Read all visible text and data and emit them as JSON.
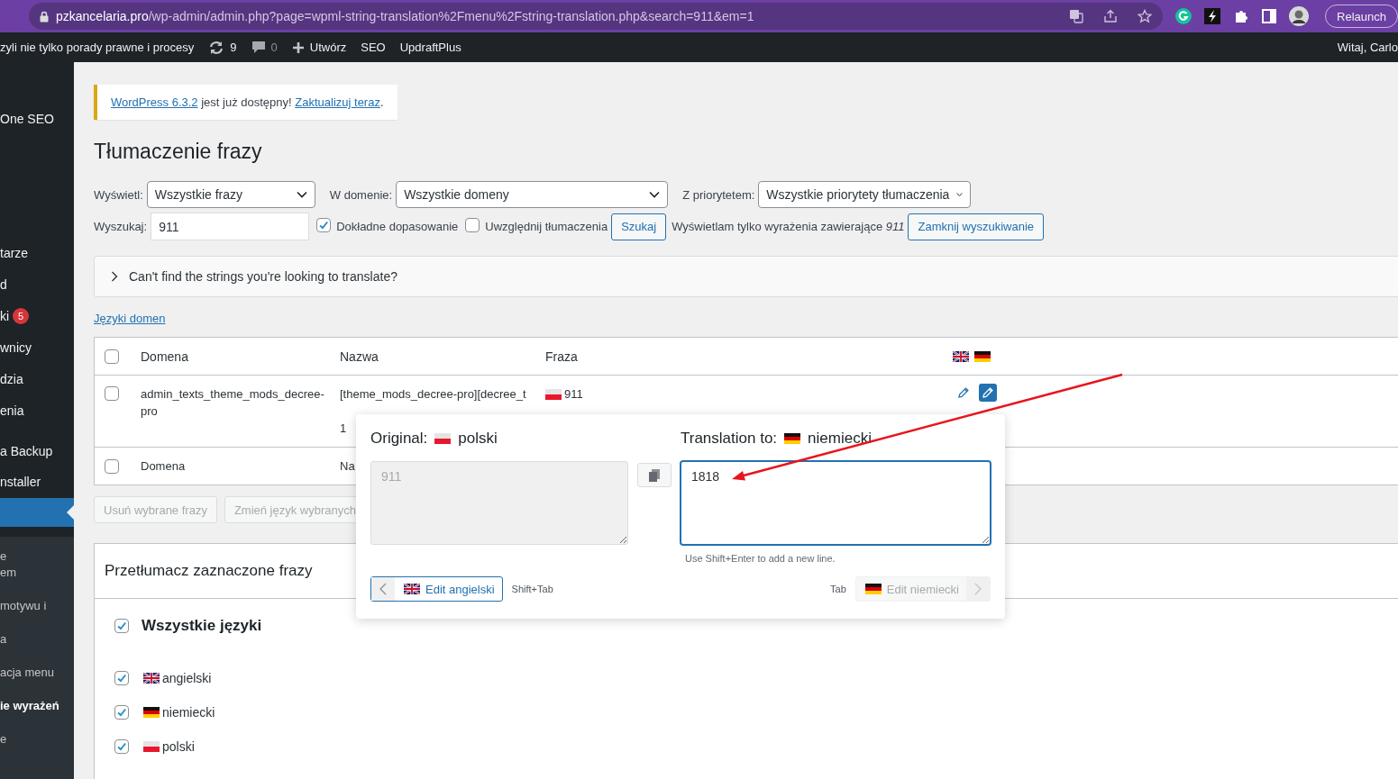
{
  "browser": {
    "url_host": "pzkancelaria.pro",
    "url_path": "/wp-admin/admin.php?page=wpml-string-translation%2Fmenu%2Fstring-translation.php&search=911&em=1",
    "relaunch": "Relaunch"
  },
  "admin_bar": {
    "site": "zyli nie tylko porady prawne i procesy",
    "updates": "9",
    "comments": "0",
    "new": "Utwórz",
    "items": [
      "SEO",
      "UpdraftPlus"
    ],
    "greeting": "Witaj, Carlo"
  },
  "sidebar": {
    "groups": [
      {
        "items": [
          {
            "label": "One SEO",
            "selected": false
          }
        ]
      },
      {
        "items": [
          {
            "label": "tarze",
            "selected": false
          },
          {
            "label": "d",
            "selected": false
          },
          {
            "label": "ki",
            "badge": "5",
            "selected": false
          },
          {
            "label": "wnicy",
            "selected": false
          },
          {
            "label": "dzia",
            "selected": false
          },
          {
            "label": "enia",
            "selected": false
          }
        ]
      },
      {
        "items": [
          {
            "label": "a Backup",
            "selected": false
          },
          {
            "label": "nstaller",
            "selected": false
          },
          {
            "selected": true
          }
        ]
      }
    ],
    "submenu": [
      {
        "lines": [
          "e",
          "em"
        ],
        "selected": false
      },
      {
        "lines": [
          "motywu i"
        ],
        "selected": false
      },
      {
        "lines": [
          "a"
        ],
        "selected": false
      },
      {
        "lines": [
          "acja menu"
        ],
        "selected": false
      },
      {
        "lines": [
          "ie wyrażeń"
        ],
        "selected": true
      },
      {
        "lines": [
          "e"
        ],
        "selected": false
      }
    ]
  },
  "notice": {
    "parts": [
      {
        "text": "WordPress 6.3.2",
        "kind": "link"
      },
      {
        "text": " jest już dostępny! ",
        "kind": "text"
      },
      {
        "text": "Zaktualizuj teraz",
        "kind": "link"
      },
      {
        "text": ".",
        "kind": "text"
      }
    ]
  },
  "title": "Tłumaczenie frazy",
  "filters": [
    {
      "label": "Wyświetl:",
      "value": "Wszystkie frazy"
    },
    {
      "label": "W domenie:",
      "value": "Wszystkie domeny"
    },
    {
      "label": "Z priorytetem:",
      "value": "Wszystkie priorytety tłumaczenia"
    }
  ],
  "search": {
    "label": "Wyszukaj:",
    "value": "911",
    "options": [
      {
        "label": "Dokładne dopasowanie",
        "checked": true
      },
      {
        "label": "Uwzględnij tłumaczenia",
        "checked": false
      }
    ],
    "button": "Szukaj",
    "info": "Wyświetlam tylko wyrażenia zawierające *911*",
    "close_button": "Zamknij wyszukiwanie"
  },
  "help_panel": {
    "text": "Can't find the strings you're looking to translate?",
    "expanded": false
  },
  "domain_languages_link": "Języki domen",
  "table": {
    "columns": [
      "Domena",
      "Nazwa",
      "Fraza"
    ],
    "header_checked": false,
    "header_flags": [
      {
        "kind": "gb"
      },
      {
        "kind": "de"
      }
    ],
    "rows": [
      {
        "checked": false,
        "domain": "admin_texts_theme_mods_decree-pro",
        "name_lines": [
          "[theme_mods_decree-pro][decree_t",
          "1"
        ],
        "phrase": {
          "kind": "pl",
          "text": "911"
        },
        "translations": [
          {
            "selected": false
          },
          {
            "selected": true
          }
        ]
      }
    ],
    "footer": {
      "checked": false,
      "columns": [
        "Domena",
        "Na"
      ]
    }
  },
  "bulk_buttons": [
    {
      "label": "Usuń wybrane frazy",
      "disabled": true
    },
    {
      "label": "Zmień język wybranych",
      "disabled": true
    }
  ],
  "translate_panel": {
    "title": "Przetłumacz zaznaczone frazy",
    "all": {
      "label": "Wszystkie języki",
      "checked": true
    },
    "languages": [
      {
        "kind": "gb",
        "label": "angielski",
        "checked": true
      },
      {
        "kind": "de",
        "label": "niemiecki",
        "checked": true
      },
      {
        "kind": "pl",
        "label": "polski",
        "checked": true
      }
    ]
  },
  "translation_dialog": {
    "original_label": "Original:",
    "original_language": {
      "kind": "pl",
      "name": "polski"
    },
    "translation_label": "Translation to:",
    "target_language": {
      "kind": "de",
      "name": "niemiecki"
    },
    "original_text": "911",
    "translation_value": "1818",
    "hint": "Use Shift+Enter to add a new line.",
    "prev": {
      "kind": "gb",
      "label": "Edit angielski",
      "disabled": false
    },
    "prev_shortcut": "Shift+Tab",
    "next_shortcut": "Tab",
    "next": {
      "kind": "de",
      "label": "Edit niemiecki",
      "disabled": true
    }
  }
}
